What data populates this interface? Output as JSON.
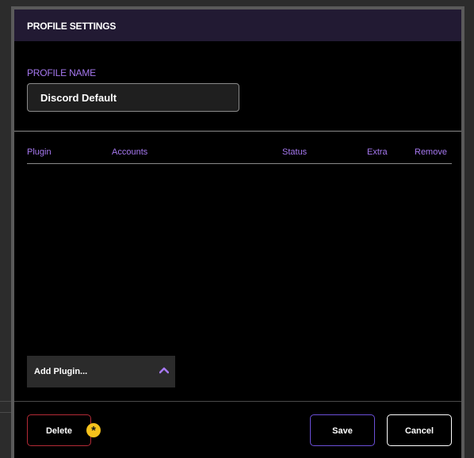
{
  "header": {
    "title": "PROFILE SETTINGS"
  },
  "profile": {
    "label": "PROFILE NAME",
    "name_value": "Discord Default"
  },
  "table": {
    "columns": [
      "Plugin",
      "Accounts",
      "Status",
      "Extra",
      "Remove"
    ],
    "rows": []
  },
  "add_plugin": {
    "label": "Add Plugin...",
    "icon": "chevron-up-icon"
  },
  "footer": {
    "delete_label": "Delete",
    "save_label": "Save",
    "cancel_label": "Cancel",
    "marker_icon": "asterisk-marker-icon",
    "marker_glyph": "*"
  },
  "colors": {
    "accent_purple": "#a678f0",
    "header_bg": "#221a33",
    "delete_border": "#b42a36",
    "save_border": "#6b4fd8",
    "marker_yellow": "#f6c21c"
  }
}
